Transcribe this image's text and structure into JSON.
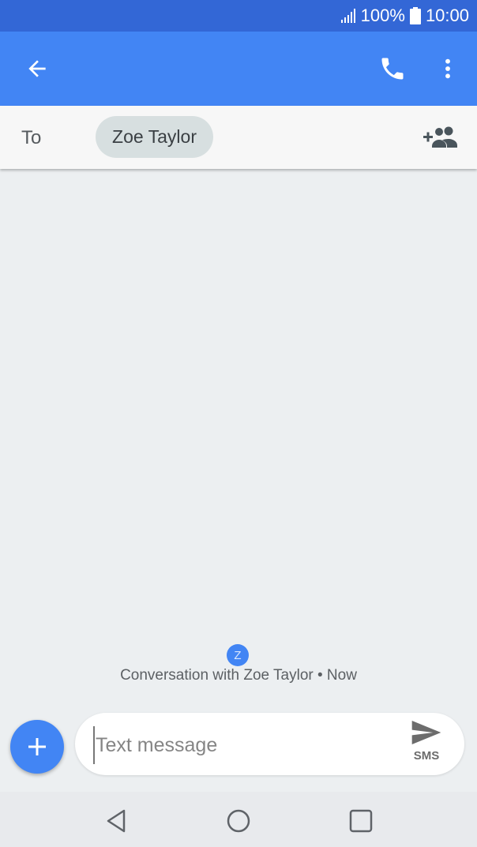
{
  "status_bar": {
    "battery": "100%",
    "time": "10:00"
  },
  "header": {
    "icons": [
      "arrow-back-icon",
      "phone-icon",
      "more-vert-icon"
    ]
  },
  "recipients": {
    "to_label": "To",
    "chip_name": "Zoe Taylor",
    "add_icon": "add-people-icon"
  },
  "conversation": {
    "avatar_letter": "Z",
    "info": "Conversation with Zoe Taylor • Now"
  },
  "composer": {
    "placeholder": "Text message",
    "send_label": "SMS"
  },
  "colors": {
    "status_bar": "#3367d6",
    "app_bar": "#4285f4",
    "background": "#eceff1",
    "chip": "#d7dfe0"
  }
}
